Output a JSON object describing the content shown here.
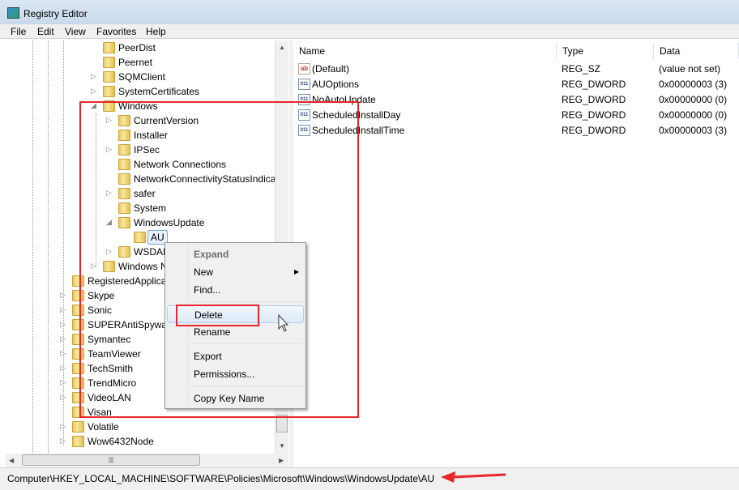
{
  "window": {
    "title": "Registry Editor"
  },
  "menu": [
    "File",
    "Edit",
    "View",
    "Favorites",
    "Help"
  ],
  "tree": [
    {
      "label": "PeerDist",
      "level": 2,
      "expander": "none"
    },
    {
      "label": "Peernet",
      "level": 2,
      "expander": "none"
    },
    {
      "label": "SQMClient",
      "level": 2,
      "expander": "collapsed"
    },
    {
      "label": "SystemCertificates",
      "level": 2,
      "expander": "collapsed"
    },
    {
      "label": "Windows",
      "level": 2,
      "expander": "expanded"
    },
    {
      "label": "CurrentVersion",
      "level": 3,
      "expander": "collapsed"
    },
    {
      "label": "Installer",
      "level": 3,
      "expander": "none"
    },
    {
      "label": "IPSec",
      "level": 3,
      "expander": "collapsed"
    },
    {
      "label": "Network Connections",
      "level": 3,
      "expander": "none"
    },
    {
      "label": "NetworkConnectivityStatusIndica",
      "level": 3,
      "expander": "none"
    },
    {
      "label": "safer",
      "level": 3,
      "expander": "collapsed"
    },
    {
      "label": "System",
      "level": 3,
      "expander": "none"
    },
    {
      "label": "WindowsUpdate",
      "level": 3,
      "expander": "expanded"
    },
    {
      "label": "AU",
      "level": 4,
      "expander": "none",
      "selected": true
    },
    {
      "label": "WSDAPI",
      "level": 3,
      "expander": "collapsed"
    },
    {
      "label": "Windows NT",
      "level": 2,
      "expander": "collapsed"
    },
    {
      "label": "RegisteredApplications",
      "level": 1,
      "expander": "none"
    },
    {
      "label": "Skype",
      "level": 1,
      "expander": "collapsed"
    },
    {
      "label": "Sonic",
      "level": 1,
      "expander": "collapsed"
    },
    {
      "label": "SUPERAntiSpyware",
      "level": 1,
      "expander": "collapsed"
    },
    {
      "label": "Symantec",
      "level": 1,
      "expander": "collapsed"
    },
    {
      "label": "TeamViewer",
      "level": 1,
      "expander": "collapsed"
    },
    {
      "label": "TechSmith",
      "level": 1,
      "expander": "collapsed"
    },
    {
      "label": "TrendMicro",
      "level": 1,
      "expander": "collapsed"
    },
    {
      "label": "VideoLAN",
      "level": 1,
      "expander": "collapsed"
    },
    {
      "label": "Visan",
      "level": 1,
      "expander": "none"
    },
    {
      "label": "Volatile",
      "level": 1,
      "expander": "collapsed"
    },
    {
      "label": "Wow6432Node",
      "level": 1,
      "expander": "collapsed"
    }
  ],
  "list": {
    "columns": [
      "Name",
      "Type",
      "Data"
    ],
    "rows": [
      {
        "icon": "string-value-icon",
        "name": "(Default)",
        "type": "REG_SZ",
        "data": "(value not set)"
      },
      {
        "icon": "dword-value-icon",
        "name": "AUOptions",
        "type": "REG_DWORD",
        "data": "0x00000003 (3)"
      },
      {
        "icon": "dword-value-icon",
        "name": "NoAutoUpdate",
        "type": "REG_DWORD",
        "data": "0x00000000 (0)"
      },
      {
        "icon": "dword-value-icon",
        "name": "ScheduledInstallDay",
        "type": "REG_DWORD",
        "data": "0x00000000 (0)"
      },
      {
        "icon": "dword-value-icon",
        "name": "ScheduledInstallTime",
        "type": "REG_DWORD",
        "data": "0x00000003 (3)"
      }
    ]
  },
  "context_menu": {
    "items": [
      {
        "label": "Expand",
        "disabled": true
      },
      {
        "label": "New",
        "submenu": true
      },
      {
        "label": "Find..."
      },
      {
        "separator": true
      },
      {
        "label": "Delete",
        "highlighted": true
      },
      {
        "label": "Rename"
      },
      {
        "separator": true
      },
      {
        "label": "Export"
      },
      {
        "label": "Permissions..."
      },
      {
        "separator": true
      },
      {
        "label": "Copy Key Name"
      }
    ]
  },
  "status": {
    "path": "Computer\\HKEY_LOCAL_MACHINE\\SOFTWARE\\Policies\\Microsoft\\Windows\\WindowsUpdate\\AU"
  },
  "annotation_color": "#e8262b"
}
